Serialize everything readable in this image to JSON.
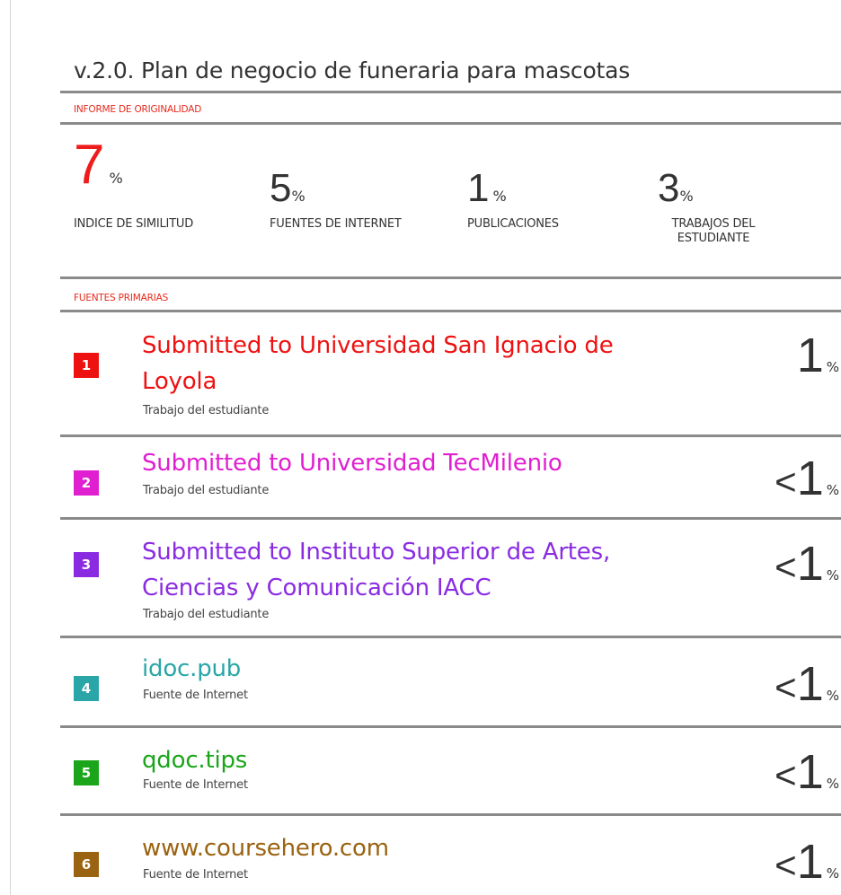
{
  "title": "v.2.0. Plan de negocio de funeraria para mascotas",
  "report_label": "INFORME DE ORIGINALIDAD",
  "stats": [
    {
      "value": "7",
      "unit": "%",
      "label": "INDICE DE SIMILITUD"
    },
    {
      "value": "5",
      "unit": "%",
      "label": "FUENTES DE INTERNET"
    },
    {
      "value": "1",
      "unit": "%",
      "label": "PUBLICACIONES"
    },
    {
      "value": "3",
      "unit": "%",
      "label_line1": "TRABAJOS DEL",
      "label_line2": "ESTUDIANTE"
    }
  ],
  "sources_label": "FUENTES PRIMARIAS",
  "sources": [
    {
      "rank": "1",
      "name_line1": "Submitted to Universidad San Ignacio de",
      "name_line2": "Loyola",
      "type": "Trabajo del estudiante",
      "prefix": "",
      "value": "1",
      "unit": "%",
      "color": "#ee1111"
    },
    {
      "rank": "2",
      "name_line1": "Submitted to Universidad TecMilenio",
      "name_line2": "",
      "type": "Trabajo del estudiante",
      "prefix": "<",
      "value": "1",
      "unit": "%",
      "color": "#e01fd0"
    },
    {
      "rank": "3",
      "name_line1": "Submitted to Instituto Superior de Artes,",
      "name_line2": "Ciencias y Comunicación IACC",
      "type": "Trabajo del estudiante",
      "prefix": "<",
      "value": "1",
      "unit": "%",
      "color": "#8a2be2"
    },
    {
      "rank": "4",
      "name_line1": "idoc.pub",
      "name_line2": "",
      "type": "Fuente de Internet",
      "prefix": "<",
      "value": "1",
      "unit": "%",
      "color": "#2aa6a8"
    },
    {
      "rank": "5",
      "name_line1": "qdoc.tips",
      "name_line2": "",
      "type": "Fuente de Internet",
      "prefix": "<",
      "value": "1",
      "unit": "%",
      "color": "#1aa51a"
    },
    {
      "rank": "6",
      "name_line1": "www.coursehero.com",
      "name_line2": "",
      "type": "Fuente de Internet",
      "prefix": "<",
      "value": "1",
      "unit": "%",
      "color": "#9a6311"
    }
  ]
}
